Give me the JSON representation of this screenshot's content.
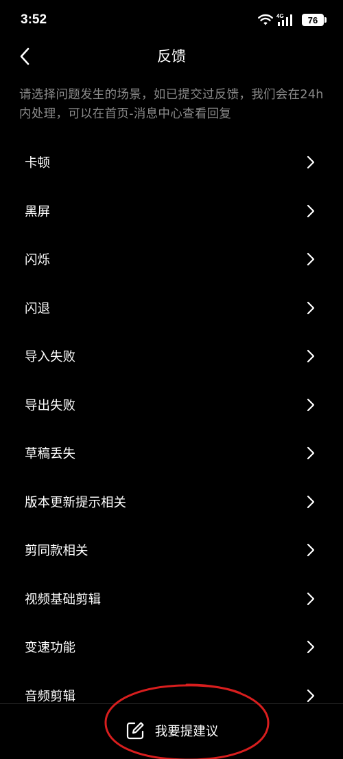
{
  "status_bar": {
    "time": "3:52",
    "network": "4G",
    "battery": "76"
  },
  "header": {
    "title": "反馈"
  },
  "description": "请选择问题发生的场景，如已提交过反馈，我们会在24h内处理，可以在首页-消息中心查看回复",
  "items": [
    {
      "label": "卡顿"
    },
    {
      "label": "黑屏"
    },
    {
      "label": "闪烁"
    },
    {
      "label": "闪退"
    },
    {
      "label": "导入失败"
    },
    {
      "label": "导出失败"
    },
    {
      "label": "草稿丢失"
    },
    {
      "label": "版本更新提示相关"
    },
    {
      "label": "剪同款相关"
    },
    {
      "label": "视频基础剪辑"
    },
    {
      "label": "变速功能"
    },
    {
      "label": "音频剪辑"
    }
  ],
  "bottom": {
    "suggest_label": "我要提建议",
    "icon": "edit-icon"
  },
  "colors": {
    "background": "#000000",
    "text": "#ffffff",
    "secondary_text": "#8a8a8a",
    "annotation": "#d81e1e"
  }
}
